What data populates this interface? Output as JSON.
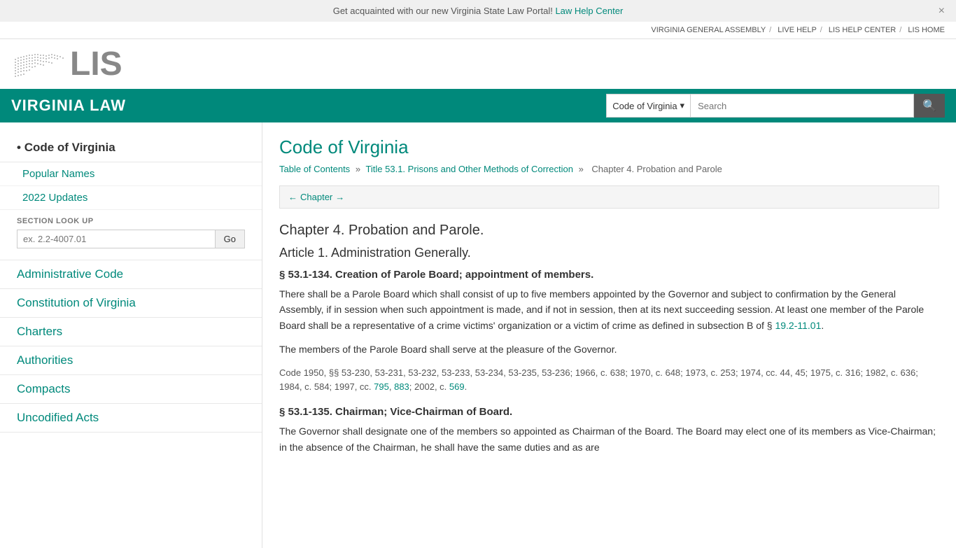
{
  "notification": {
    "text": "Get acquainted with our new Virginia State Law Portal!",
    "link_text": "Law Help Center",
    "close_label": "×"
  },
  "utility_nav": {
    "items": [
      {
        "label": "VIRGINIA GENERAL ASSEMBLY",
        "url": "#"
      },
      {
        "label": "LIVE HELP",
        "url": "#"
      },
      {
        "label": "LIS HELP CENTER",
        "url": "#"
      },
      {
        "label": "LIS HOME",
        "url": "#"
      }
    ],
    "separators": "/"
  },
  "header": {
    "logo_text": "LIS",
    "site_title": "VIRGINIA LAW"
  },
  "search": {
    "dropdown_label": "Code of Virginia",
    "placeholder": "Search",
    "button_icon": "🔍"
  },
  "sidebar": {
    "items": [
      {
        "label": "Code of Virginia",
        "active": true,
        "url": "#"
      },
      {
        "label": "Popular Names",
        "sub": true,
        "url": "#"
      },
      {
        "label": "2022 Updates",
        "sub": true,
        "url": "#"
      },
      {
        "label": "section_lookup",
        "special": true
      },
      {
        "label": "Administrative Code",
        "url": "#"
      },
      {
        "label": "Constitution of Virginia",
        "url": "#"
      },
      {
        "label": "Charters",
        "url": "#"
      },
      {
        "label": "Authorities",
        "url": "#"
      },
      {
        "label": "Compacts",
        "url": "#"
      },
      {
        "label": "Uncodified Acts",
        "url": "#"
      }
    ],
    "section_lookup": {
      "label": "SECTION LOOK UP",
      "placeholder": "ex. 2.2-4007.01",
      "button_label": "Go"
    }
  },
  "content": {
    "title": "Code of Virginia",
    "breadcrumb": {
      "table_of_contents": "Table of Contents",
      "separator": "»",
      "title_link": "Title 53.1. Prisons and Other Methods of Correction",
      "chapter": "Chapter 4. Probation and Parole"
    },
    "chapter_nav": {
      "back_label": "← Chapter →"
    },
    "chapter_heading": "Chapter 4. Probation and Parole.",
    "article_heading": "Article 1. Administration Generally.",
    "sections": [
      {
        "id": "53.1-134",
        "heading": "§ 53.1-134. Creation of Parole Board; appointment of members.",
        "paragraphs": [
          "There shall be a Parole Board which shall consist of up to five members appointed by the Governor and subject to confirmation by the General Assembly, if in session when such appointment is made, and if not in session, then at its next succeeding session. At least one member of the Parole Board shall be a representative of a crime victims' organization or a victim of crime as defined in subsection B of § 19.2-11.01.",
          "The members of the Parole Board shall serve at the pleasure of the Governor.",
          "Code 1950, §§ 53-230, 53-231, 53-232, 53-233, 53-234, 53-235, 53-236; 1966, c. 638; 1970, c. 648; 1973, c. 253; 1974, cc. 44, 45; 1975, c. 316; 1982, c. 636; 1984, c. 584; 1997, cc. 795, 883; 2002, c. 569."
        ],
        "inline_links": [
          {
            "text": "19.2-11.01",
            "url": "#"
          },
          {
            "text": "795",
            "url": "#"
          },
          {
            "text": "883",
            "url": "#"
          },
          {
            "text": "569",
            "url": "#"
          }
        ]
      },
      {
        "id": "53.1-135",
        "heading": "§ 53.1-135. Chairman; Vice-Chairman of Board.",
        "paragraphs": [
          "The Governor shall designate one of the members so appointed as Chairman of the Board. The Board may elect one of its members as Vice-Chairman; in the absence of the Chairman, he shall have the same duties and as are"
        ]
      }
    ]
  }
}
